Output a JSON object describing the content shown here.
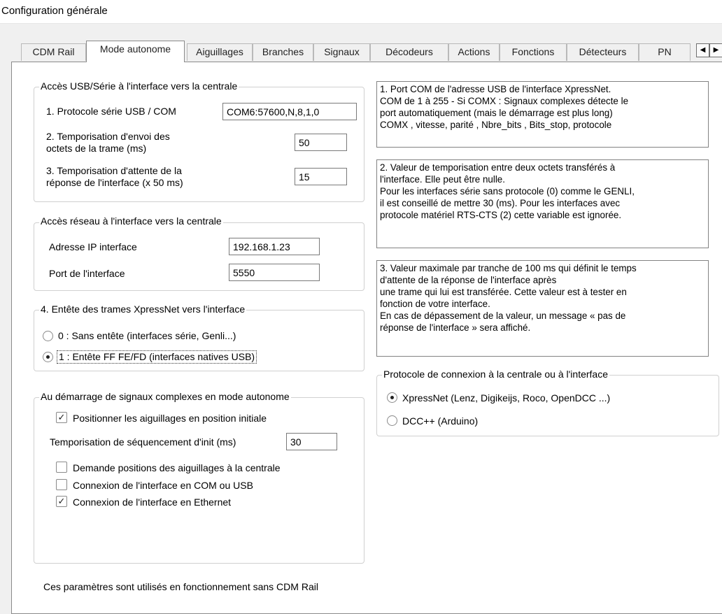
{
  "window": {
    "title": "Configuration générale"
  },
  "tabs": [
    {
      "label": "CDM Rail",
      "active": false
    },
    {
      "label": "Mode autonome",
      "active": true
    },
    {
      "label": "Aiguillages",
      "active": false
    },
    {
      "label": "Branches",
      "active": false
    },
    {
      "label": "Signaux",
      "active": false
    },
    {
      "label": "Décodeurs",
      "active": false
    },
    {
      "label": "Actions",
      "active": false
    },
    {
      "label": "Fonctions",
      "active": false
    },
    {
      "label": "Détecteurs",
      "active": false
    },
    {
      "label": "PN",
      "active": false
    }
  ],
  "tab_scroll": {
    "left_glyph": "◀",
    "right_glyph": "▶"
  },
  "usb": {
    "legend": "Accès USB/Série à l'interface vers la centrale",
    "protocol_label": "1. Protocole série USB / COM",
    "protocol_value": "COM6:57600,N,8,1,0",
    "send_delay_label": "2. Temporisation d'envoi des\noctets de la trame (ms)",
    "send_delay_value": "50",
    "wait_delay_label": "3. Temporisation d'attente de la\nréponse de l'interface (x 50 ms)",
    "wait_delay_value": "15"
  },
  "network": {
    "legend": "Accès réseau à l'interface vers la centrale",
    "ip_label": "Adresse IP interface",
    "ip_value": "192.168.1.23",
    "port_label": "Port de l'interface",
    "port_value": "5550"
  },
  "header": {
    "legend": "4. Entête des trames XpressNet vers l'interface",
    "option0": "0 : Sans entête (interfaces série, Genli...)",
    "option1": "1 : Entête FF FE/FD (interfaces natives USB)",
    "selected": 1
  },
  "startup": {
    "legend": "Au démarrage de signaux complexes en mode autonome",
    "position_init_label": "Positionner les aiguillages en position initiale",
    "position_init_checked": true,
    "seq_delay_label": "Temporisation de séquencement d'init (ms)",
    "seq_delay_value": "30",
    "ask_positions_label": "Demande positions des aiguillages à la centrale",
    "ask_positions_checked": false,
    "conn_com_label": "Connexion de l'interface en COM ou USB",
    "conn_com_checked": false,
    "conn_eth_label": "Connexion de l'interface en Ethernet",
    "conn_eth_checked": true
  },
  "help": {
    "box1": "1. Port COM de l'adresse USB de l'interface XpressNet.\nCOM de 1 à 255 - Si COMX : Signaux complexes détecte le\nport automatiquement (mais le démarrage est plus long)\nCOMX , vitesse, parité , Nbre_bits , Bits_stop, protocole",
    "box2": "2. Valeur de temporisation entre deux octets transférés à\nl'interface. Elle peut être nulle.\nPour les interfaces série sans protocole (0) comme le GENLI,\nil est conseillé de mettre 30 (ms). Pour les interfaces avec\nprotocole matériel RTS-CTS (2) cette variable est ignorée.",
    "box3": "3. Valeur maximale par tranche de 100 ms qui définit le temps\nd'attente de la réponse de l'interface après\nune trame qui lui est transférée. Cette valeur est à tester en\nfonction de votre interface.\nEn cas de dépassement de la valeur, un message « pas de\nréponse de l'interface » sera affiché."
  },
  "protocol": {
    "legend": "Protocole de connexion à la centrale ou à l'interface",
    "option_xpressnet": "XpressNet (Lenz, Digikeijs, Roco, OpenDCC ...)",
    "option_dcc": "DCC++ (Arduino)",
    "selected": "xpressnet"
  },
  "footer": {
    "note": "Ces paramètres sont utilisés en fonctionnement sans CDM Rail"
  }
}
